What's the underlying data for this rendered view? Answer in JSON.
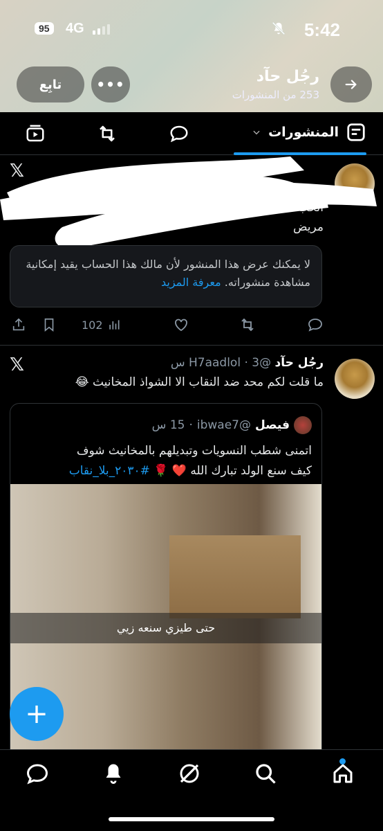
{
  "status_bar": {
    "time": "5:42",
    "battery": "95",
    "network": "4G"
  },
  "profile": {
    "name": "رجُل حآد",
    "posts_count": "253 من المنشورات",
    "follow_label": "تابِع",
    "more_label": "•••"
  },
  "tabs": {
    "posts_label": "المنشورات"
  },
  "post1": {
    "visible_text": "مريض",
    "partial_text": "الحب",
    "blocked_message": "لا يمكنك عرض هذا المنشور لأن مالك هذا الحساب يقيد إمكانية مشاهدة منشوراته.",
    "learn_more": "معرفة المزيد",
    "views": "102"
  },
  "post2": {
    "author": "رجُل حآد",
    "handle": "@H7aadlol",
    "time": "3 س",
    "text": "ما قلت لكم محد ضد النقاب الا الشواذ المخانيث 😂",
    "quote": {
      "author": "فيصل",
      "handle": "@ibwae7",
      "time": "15 س",
      "text_line1": "اتمنى شطب النسويات وتبديلهم بالمخانيث شوف",
      "text_line2": "كيف سنع الولد تبارك الله ❤️ 🌹 ",
      "hashtag": "#٢٠٣٠_بلا_نقاب",
      "media_caption": "حتى طيزي سنعه زيي"
    }
  },
  "fab_label": "+",
  "colors": {
    "accent": "#1d9bf0",
    "background": "#000000",
    "border": "#2f3336",
    "muted": "#8b98a5"
  }
}
